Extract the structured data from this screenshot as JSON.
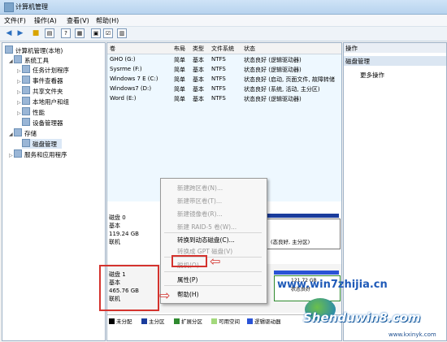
{
  "window": {
    "title": "计算机管理"
  },
  "menu": [
    "文件(F)",
    "操作(A)",
    "查看(V)",
    "帮助(H)"
  ],
  "tree": {
    "root": "计算机管理(本地)",
    "system_tools": "系统工具",
    "items": [
      "任务计划程序",
      "事件查看器",
      "共享文件夹",
      "本地用户和组",
      "性能",
      "设备管理器"
    ],
    "storage": "存储",
    "disk_mgmt": "磁盘管理",
    "services": "服务和应用程序"
  },
  "volumes": {
    "headers": [
      "卷",
      "布局",
      "类型",
      "文件系统",
      "状态"
    ],
    "rows": [
      [
        "GHO (G:)",
        "简单",
        "基本",
        "NTFS",
        "状态良好 (逻辑驱动器)"
      ],
      [
        "Sysrme (F:)",
        "简单",
        "基本",
        "NTFS",
        "状态良好 (逻辑驱动器)"
      ],
      [
        "Windows 7 E (C:)",
        "简单",
        "基本",
        "NTFS",
        "状态良好 (启动, 页面文件, 故障转储"
      ],
      [
        "Windows7 (D:)",
        "简单",
        "基本",
        "NTFS",
        "状态良好 (系统, 活动, 主分区)"
      ],
      [
        "Word (E:)",
        "简单",
        "基本",
        "NTFS",
        "状态良好 (逻辑驱动器)"
      ]
    ]
  },
  "disk0": {
    "name": "磁盘 0",
    "type": "基本",
    "size": "119.24 GB",
    "status": "联机",
    "part_text": "(态良好, 主分区)"
  },
  "disk1": {
    "name": "磁盘 1",
    "type": "基本",
    "size": "465.76 GB",
    "status": "联机",
    "part_size": "121.72 GB",
    "part_status": "状态良好"
  },
  "legend": [
    "未分配",
    "主分区",
    "扩展分区",
    "可用空间",
    "逻辑驱动器"
  ],
  "actions": {
    "header": "操作",
    "selected": "磁盘管理",
    "more": "更多操作"
  },
  "context_menu": [
    {
      "label": "新建跨区卷(N)...",
      "enabled": false
    },
    {
      "label": "新建带区卷(T)...",
      "enabled": false
    },
    {
      "label": "新建镜像卷(R)...",
      "enabled": false
    },
    {
      "label": "新建 RAID-5 卷(W)...",
      "enabled": false
    },
    {
      "label": "转换到动态磁盘(C)...",
      "enabled": true
    },
    {
      "label": "转换成 GPT 磁盘(V)",
      "enabled": false
    },
    {
      "label": "脱机(O)",
      "enabled": false
    },
    {
      "label": "属性(P)",
      "enabled": true
    },
    {
      "label": "帮助(H)",
      "enabled": true
    }
  ],
  "watermark": {
    "site": "www.win7zhijia.cn",
    "brand": "Shenduwin8.com",
    "url": "www.kxinyk.com"
  },
  "colors": {
    "primary_partition": "#1a3c9c",
    "logical_drive": "#2a53d6",
    "unallocated": "#000000",
    "extended": "#2f8a2f",
    "free_space": "#a3d97c",
    "highlight": "#d4332e"
  }
}
